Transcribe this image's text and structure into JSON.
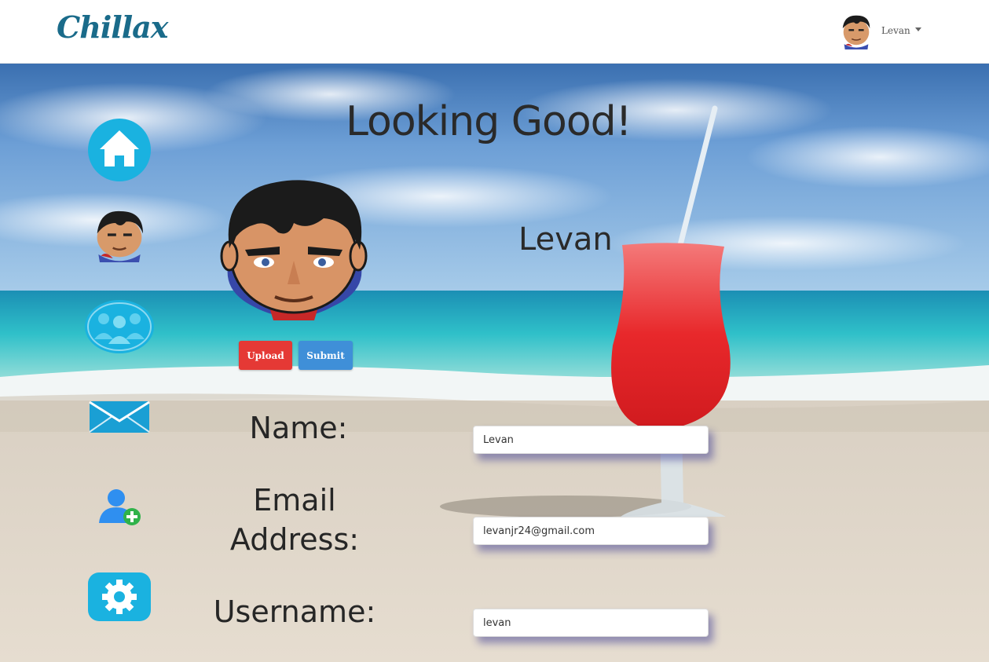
{
  "navbar": {
    "brand": "Chillax",
    "user": {
      "name": "Levan",
      "avatar_icon": "superman-avatar-icon"
    }
  },
  "sidebar": {
    "items": [
      {
        "name": "home",
        "icon": "home-icon"
      },
      {
        "name": "profile",
        "icon": "superman-avatar-icon"
      },
      {
        "name": "groups",
        "icon": "group-icon"
      },
      {
        "name": "messages",
        "icon": "envelope-icon"
      },
      {
        "name": "add-friend",
        "icon": "add-user-icon"
      },
      {
        "name": "settings",
        "icon": "gear-icon"
      }
    ]
  },
  "profile": {
    "heading": "Looking Good!",
    "display_name": "Levan",
    "upload_label": "Upload",
    "submit_label": "Submit",
    "avatar_icon": "superman-avatar-icon"
  },
  "form": {
    "name_label": "Name:",
    "name_value": "Levan",
    "email_label_line1": "Email",
    "email_label_line2": "Address:",
    "email_value": "levanjr24@gmail.com",
    "username_label": "Username:",
    "username_value": "levan"
  },
  "colors": {
    "brand": "#1a6b8a",
    "upload_button": "#e53935",
    "submit_button": "#3f8fd8",
    "sidebar_icon": "#1ab2e0"
  }
}
